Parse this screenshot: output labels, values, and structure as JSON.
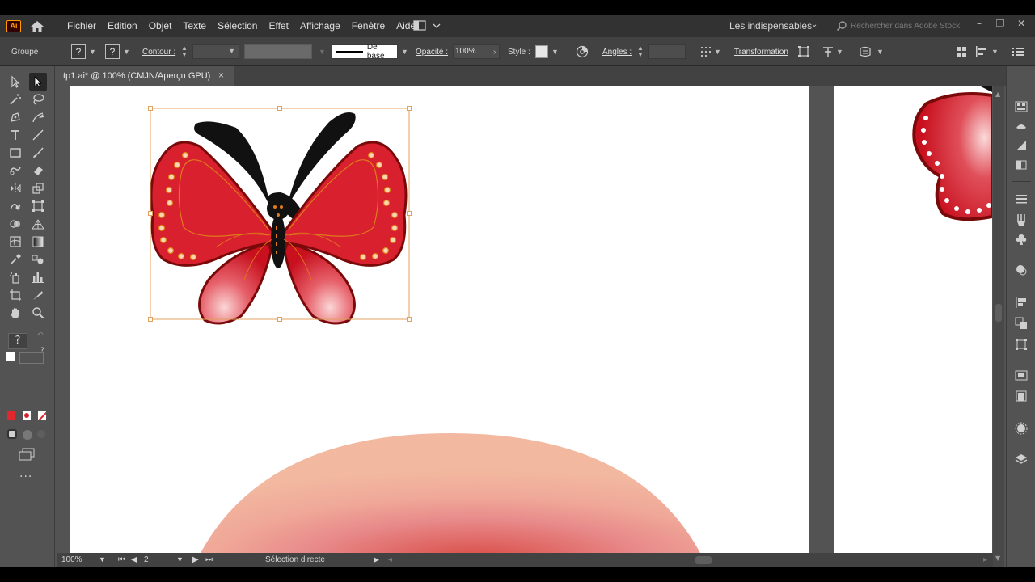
{
  "app": {
    "logo": "Ai",
    "menus": [
      "Fichier",
      "Edition",
      "Objet",
      "Texte",
      "Sélection",
      "Effet",
      "Affichage",
      "Fenêtre",
      "Aide"
    ],
    "workspace": "Les indispensables",
    "stock_search_placeholder": "Rechercher dans Adobe Stock"
  },
  "controlbar": {
    "selection_type": "Groupe",
    "question_mark": "?",
    "contour_label": "Contour :",
    "stroke_profile": "De base",
    "opacity_label": "Opacité :",
    "opacity_value": "100%",
    "style_label": "Style :",
    "angles_label": "Angles :",
    "transform_label": "Transformation"
  },
  "document": {
    "tab_title": "tp1.ai* @ 100% (CMJN/Aperçu GPU)",
    "close_glyph": "×"
  },
  "status": {
    "zoom": "100%",
    "artboard_number": "2",
    "tool_name": "Sélection directe"
  },
  "toolbar": {
    "swap_hint": "?"
  },
  "colors": {
    "wing_red": "#d8202f",
    "wing_outline": "#7a0a0a",
    "selection_bbox": "#e0a15c",
    "body_black": "#111111",
    "dot_orange": "#f0a030"
  }
}
